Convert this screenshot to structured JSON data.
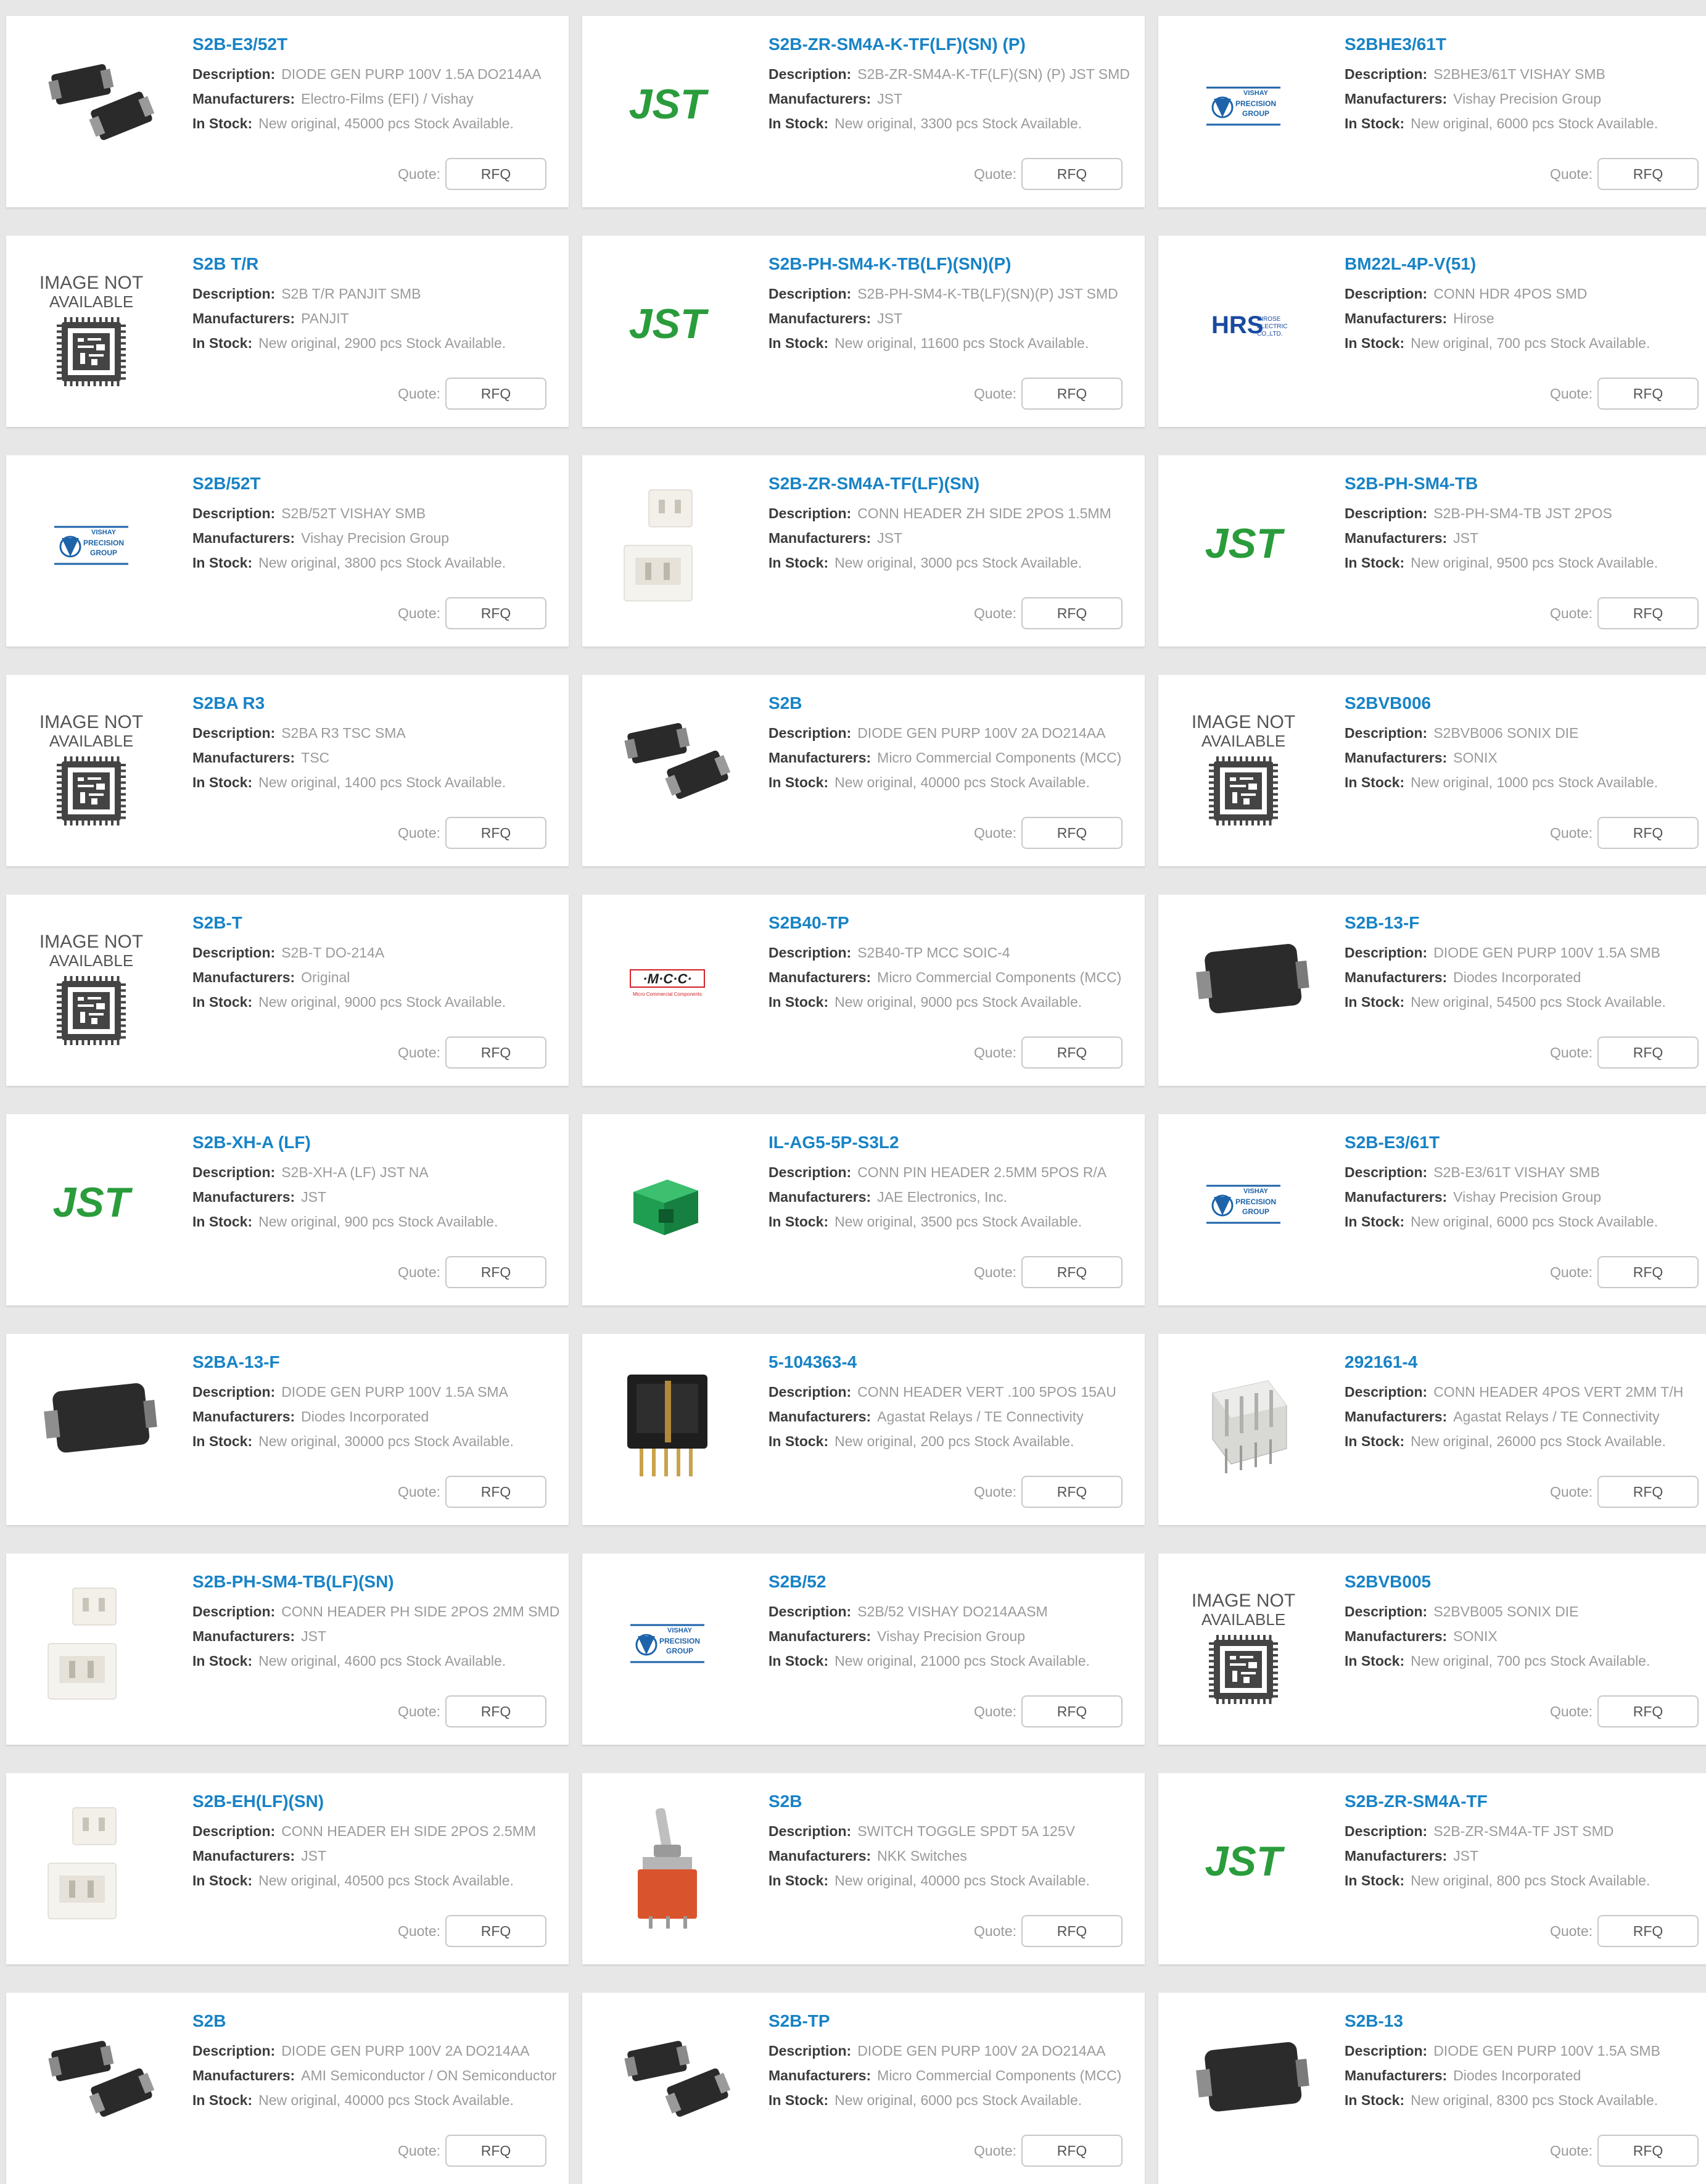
{
  "labels": {
    "description": "Description:",
    "manufacturers": "Manufacturers:",
    "in_stock": "In Stock:",
    "quote": "Quote:",
    "rfq": "RFQ"
  },
  "products": [
    {
      "pn": "S2B-E3/52T",
      "desc": "DIODE GEN PURP 100V 1.5A DO214AA",
      "mfr": "Electro-Films (EFI) / Vishay",
      "stock": "New original, 45000 pcs Stock Available.",
      "image": "smd-diode-pair"
    },
    {
      "pn": "S2B-ZR-SM4A-K-TF(LF)(SN) (P)",
      "desc": "S2B-ZR-SM4A-K-TF(LF)(SN) (P) JST SMD",
      "mfr": "JST",
      "stock": "New original, 3300 pcs Stock Available.",
      "image": "jst-logo"
    },
    {
      "pn": "S2BHE3/61T",
      "desc": "S2BHE3/61T VISHAY SMB",
      "mfr": "Vishay Precision Group",
      "stock": "New original, 6000 pcs Stock Available.",
      "image": "vishay-logo"
    },
    {
      "pn": "S2B T/R",
      "desc": "S2B T/R PANJIT SMB",
      "mfr": "PANJIT",
      "stock": "New original, 2900 pcs Stock Available.",
      "image": "image-not-available"
    },
    {
      "pn": "S2B-PH-SM4-K-TB(LF)(SN)(P)",
      "desc": "S2B-PH-SM4-K-TB(LF)(SN)(P) JST SMD",
      "mfr": "JST",
      "stock": "New original, 11600 pcs Stock Available.",
      "image": "jst-logo"
    },
    {
      "pn": "BM22L-4P-V(51)",
      "desc": "CONN HDR 4POS SMD",
      "mfr": "Hirose",
      "stock": "New original, 700 pcs Stock Available.",
      "image": "hirose-logo"
    },
    {
      "pn": "S2B/52T",
      "desc": "S2B/52T VISHAY SMB",
      "mfr": "Vishay Precision Group",
      "stock": "New original, 3800 pcs Stock Available.",
      "image": "vishay-logo"
    },
    {
      "pn": "S2B-ZR-SM4A-TF(LF)(SN)",
      "desc": "CONN HEADER ZH SIDE 2POS 1.5MM",
      "mfr": "JST",
      "stock": "New original, 3000 pcs Stock Available.",
      "image": "white-connector"
    },
    {
      "pn": "S2B-PH-SM4-TB",
      "desc": "S2B-PH-SM4-TB JST 2POS",
      "mfr": "JST",
      "stock": "New original, 9500 pcs Stock Available.",
      "image": "jst-logo"
    },
    {
      "pn": "S2BA R3",
      "desc": "S2BA R3 TSC SMA",
      "mfr": "TSC",
      "stock": "New original, 1400 pcs Stock Available.",
      "image": "image-not-available"
    },
    {
      "pn": "S2B",
      "desc": "DIODE GEN PURP 100V 2A DO214AA",
      "mfr": "Micro Commercial Components (MCC)",
      "stock": "New original, 40000 pcs Stock Available.",
      "image": "smd-diode-pair"
    },
    {
      "pn": "S2BVB006",
      "desc": "S2BVB006 SONIX DIE",
      "mfr": "SONIX",
      "stock": "New original, 1000 pcs Stock Available.",
      "image": "image-not-available"
    },
    {
      "pn": "S2B-T",
      "desc": "S2B-T    DO-214A",
      "mfr": "Original",
      "stock": "New original, 9000 pcs Stock Available.",
      "image": "image-not-available"
    },
    {
      "pn": "S2B40-TP",
      "desc": "S2B40-TP MCC SOIC-4",
      "mfr": "Micro Commercial Components (MCC)",
      "stock": "New original, 9000 pcs Stock Available.",
      "image": "mcc-logo"
    },
    {
      "pn": "S2B-13-F",
      "desc": "DIODE GEN PURP 100V 1.5A SMB",
      "mfr": "Diodes Incorporated",
      "stock": "New original, 54500 pcs Stock Available.",
      "image": "smd-diode-large"
    },
    {
      "pn": "S2B-XH-A (LF)",
      "desc": "S2B-XH-A (LF) JST NA",
      "mfr": "JST",
      "stock": "New original, 900 pcs Stock Available.",
      "image": "jst-logo"
    },
    {
      "pn": "IL-AG5-5P-S3L2",
      "desc": "CONN PIN HEADER 2.5MM 5POS R/A",
      "mfr": "JAE Electronics, Inc.",
      "stock": "New original, 3500 pcs Stock Available.",
      "image": "green-header"
    },
    {
      "pn": "S2B-E3/61T",
      "desc": "S2B-E3/61T VISHAY SMB",
      "mfr": "Vishay Precision Group",
      "stock": "New original, 6000 pcs Stock Available.",
      "image": "vishay-logo"
    },
    {
      "pn": "S2BA-13-F",
      "desc": "DIODE GEN PURP 100V 1.5A SMA",
      "mfr": "Diodes Incorporated",
      "stock": "New original, 30000 pcs Stock Available.",
      "image": "smd-diode-large"
    },
    {
      "pn": "5-104363-4",
      "desc": "CONN HEADER VERT .100 5POS 15AU",
      "mfr": "Agastat Relays / TE Connectivity",
      "stock": "New original, 200 pcs Stock Available.",
      "image": "black-header"
    },
    {
      "pn": "292161-4",
      "desc": "CONN HEADER 4POS VERT 2MM T/H",
      "mfr": "Agastat Relays / TE Connectivity",
      "stock": "New original, 26000 pcs Stock Available.",
      "image": "clear-header"
    },
    {
      "pn": "S2B-PH-SM4-TB(LF)(SN)",
      "desc": "CONN HEADER PH SIDE 2POS 2MM SMD",
      "mfr": "JST",
      "stock": "New original, 4600 pcs Stock Available.",
      "image": "white-connector"
    },
    {
      "pn": "S2B/52",
      "desc": "S2B/52 VISHAY DO214AASM",
      "mfr": "Vishay Precision Group",
      "stock": "New original, 21000 pcs Stock Available.",
      "image": "vishay-logo"
    },
    {
      "pn": "S2BVB005",
      "desc": "S2BVB005 SONIX DIE",
      "mfr": "SONIX",
      "stock": "New original, 700 pcs Stock Available.",
      "image": "image-not-available"
    },
    {
      "pn": "S2B-EH(LF)(SN)",
      "desc": "CONN HEADER EH SIDE 2POS 2.5MM",
      "mfr": "JST",
      "stock": "New original, 40500 pcs Stock Available.",
      "image": "white-connector"
    },
    {
      "pn": "S2B",
      "desc": "SWITCH TOGGLE SPDT 5A 125V",
      "mfr": "NKK Switches",
      "stock": "New original, 40000 pcs Stock Available.",
      "image": "toggle-switch"
    },
    {
      "pn": "S2B-ZR-SM4A-TF",
      "desc": "S2B-ZR-SM4A-TF JST SMD",
      "mfr": "JST",
      "stock": "New original, 800 pcs Stock Available.",
      "image": "jst-logo"
    },
    {
      "pn": "S2B",
      "desc": "DIODE GEN PURP 100V 2A DO214AA",
      "mfr": "AMI Semiconductor / ON Semiconductor",
      "stock": "New original, 40000 pcs Stock Available.",
      "image": "smd-diode-pair"
    },
    {
      "pn": "S2B-TP",
      "desc": "DIODE GEN PURP 100V 2A DO214AA",
      "mfr": "Micro Commercial Components (MCC)",
      "stock": "New original, 6000 pcs Stock Available.",
      "image": "smd-diode-pair"
    },
    {
      "pn": "S2B-13",
      "desc": "DIODE GEN PURP 100V 1.5A SMB",
      "mfr": "Diodes Incorporated",
      "stock": "New original, 8300 pcs Stock Available.",
      "image": "smd-diode-large"
    }
  ],
  "logo_text": {
    "jst": "JST",
    "vishay_top": "VISHAY",
    "vishay_mid": "PRECISION",
    "vishay_bot": "GROUP",
    "hirose_mark": "HRS",
    "hirose_line1": "HIROSE",
    "hirose_line2": "ELECTRIC",
    "hirose_line3": "CO.,LTD.",
    "mcc_mark": "·M·C·C·",
    "mcc_sub": "Micro Commercial Components",
    "na_line1": "IMAGE NOT",
    "na_line2": "AVAILABLE"
  },
  "colors": {
    "link": "#1883c6",
    "jst_green": "#2a9c3c",
    "vishay_blue": "#1d63a9",
    "hirose_blue": "#1a4aa0",
    "mcc_red": "#d31f26"
  }
}
